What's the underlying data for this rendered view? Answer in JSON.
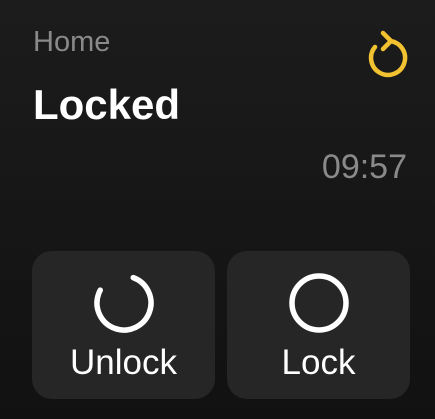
{
  "header": {
    "label": "Home",
    "refresh_icon": "refresh-icon",
    "accent_color": "#f2c230"
  },
  "status": {
    "title": "Locked",
    "time": "09:57"
  },
  "actions": [
    {
      "label": "Unlock",
      "icon": "spinner-icon"
    },
    {
      "label": "Lock",
      "icon": "circle-icon"
    }
  ]
}
